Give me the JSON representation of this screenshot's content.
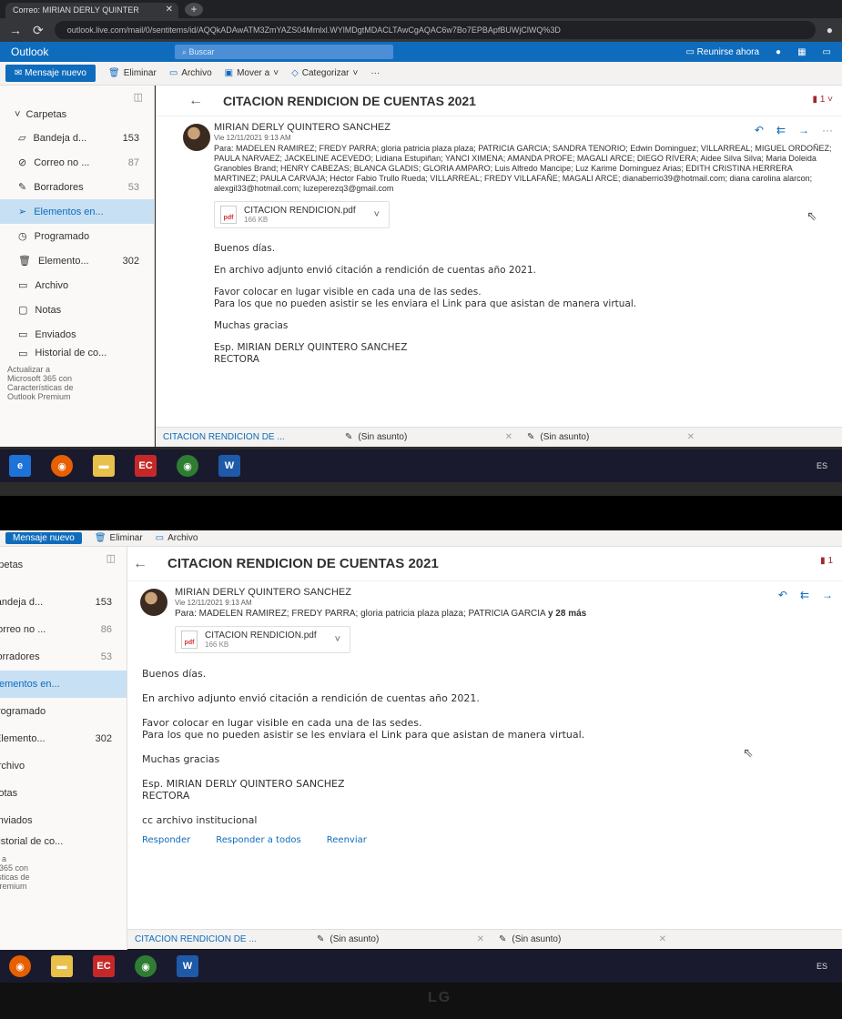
{
  "browser": {
    "tab_title": "Correo: MIRIAN DERLY QUINTER",
    "url": "outlook.live.com/mail/0/sentitems/id/AQQkADAwATM3ZmYAZS04Mmlxl.WYlMDgtMDACLTAwCgAQAC6w7Bo7EPBApfBUWjClWQ%3D"
  },
  "outlook": {
    "brand": "Outlook",
    "search_placeholder": "Buscar",
    "meet_now": "Reunirse ahora"
  },
  "commands": {
    "new_mail": "Mensaje nuevo",
    "delete": "Eliminar",
    "archive": "Archivo",
    "move_to": "Mover a",
    "categorize": "Categorizar",
    "more": "···"
  },
  "sidebar": {
    "folders_label": "Carpetas",
    "items": [
      {
        "label": "Bandeja d...",
        "count": "153"
      },
      {
        "label": "Correo no ...",
        "count": "87"
      },
      {
        "label": "Borradores",
        "count": "53"
      },
      {
        "label": "Elementos en...",
        "count": ""
      },
      {
        "label": "Programado",
        "count": ""
      },
      {
        "label": "Elemento...",
        "count": "302"
      },
      {
        "label": "Archivo",
        "count": ""
      },
      {
        "label": "Notas",
        "count": ""
      },
      {
        "label": "Enviados",
        "count": ""
      },
      {
        "label": "Historial de co...",
        "count": ""
      }
    ],
    "items2": [
      {
        "label": "Bandeja d...",
        "count": "153"
      },
      {
        "label": "Correo no ...",
        "count": "86"
      },
      {
        "label": "Borradores",
        "count": "53"
      },
      {
        "label": "Elementos en...",
        "count": ""
      },
      {
        "label": "Programado",
        "count": ""
      },
      {
        "label": "Elemento...",
        "count": "302"
      },
      {
        "label": "Archivo",
        "count": ""
      },
      {
        "label": "Notas",
        "count": ""
      },
      {
        "label": "Enviados",
        "count": ""
      },
      {
        "label": "Historial de co...",
        "count": ""
      }
    ],
    "promo": [
      "Actualizar a",
      "Microsoft 365 con",
      "Características de",
      "Outlook Premium"
    ]
  },
  "email": {
    "subject": "CITACION RENDICION DE CUENTAS 2021",
    "sender": "MIRIAN DERLY QUINTERO SANCHEZ",
    "datetime": "Vie 12/11/2021 9:13 AM",
    "to_full": "Para: MADELEN RAMIREZ; FREDY PARRA; gloria patricia plaza plaza; PATRICIA GARCIA; SANDRA TENORIO; Edwin Dominguez; VILLARREAL; MIGUEL ORDOÑEZ; PAULA NARVAEZ; JACKELINE ACEVEDO; Lidiana Estupiñan; YANCI XIMENA; AMANDA PROFE; MAGALI ARCE; DIEGO RIVERA; Aidee Silva Silva; Maria Doleida Granobles Brand; HENRY CABEZAS; BLANCA GLADIS; GLORIA AMPARO; Luis Alfredo Mancipe; Luz Karime Dominguez Arias; EDITH CRISTINA HERRERA MARTINEZ; PAULA CARVAJA; Héctor Fabio Trullo Rueda; VILLARREAL; FREDY VILLAFAÑE; MAGALI ARCE; dianaberrio39@hotmail.com; diana carolina alarcon; alexgil33@hotmail.com; luzeperezq3@gmail.com",
    "to_short": "Para: MADELEN RAMIREZ; FREDY PARRA; gloria patricia plaza plaza; PATRICIA GARCIA",
    "to_more": "y 28 más",
    "attachment_name": "CITACION RENDICION.pdf",
    "attachment_size": "166 KB",
    "attachment_badge": "pdf",
    "body": {
      "greeting": "Buenos días.",
      "line1": "En archivo adjunto envió citación a rendición de cuentas año 2021.",
      "line2": "Favor colocar en lugar visible en cada una de las sedes.",
      "line3": "Para los que no pueden asistir se les enviara el Link para que asistan de manera virtual.",
      "thanks": "Muchas gracias",
      "sig_name": "Esp. MIRIAN DERLY QUINTERO SANCHEZ",
      "sig_title": "RECTORA",
      "cc": "cc archivo institucional"
    },
    "reply_links": {
      "reply": "Responder",
      "reply_all": "Responder a todos",
      "forward": "Reenviar"
    }
  },
  "drafts": [
    {
      "label": "CITACION RENDICION DE ..."
    },
    {
      "label": "(Sin asunto)"
    },
    {
      "label": "(Sin asunto)"
    }
  ],
  "taskbar": {
    "lang": "ES",
    "word_badge": "W",
    "office_badge": "EC"
  },
  "monitor_brand": "LG",
  "colors": {
    "outlook_blue": "#0f6cbd",
    "selected_folder": "#c7e0f4"
  }
}
